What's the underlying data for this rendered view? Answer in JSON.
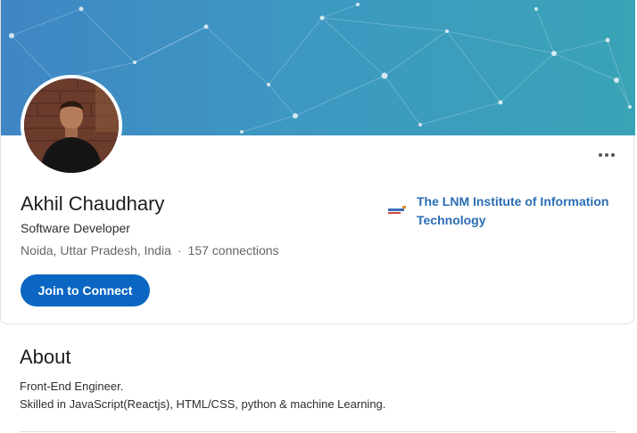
{
  "profile": {
    "name": "Akhil Chaudhary",
    "headline": "Software Developer",
    "location": "Noida, Uttar Pradesh, India",
    "separator": "·",
    "connections": "157 connections",
    "join_button": "Join to Connect",
    "more_icon": "ellipsis-icon"
  },
  "education": {
    "school": "The LNM Institute of Information Technology",
    "logo_icon": "school-logo"
  },
  "about": {
    "title": "About",
    "lines": [
      "Front-End Engineer.",
      "Skilled in JavaScript(Reactjs), HTML/CSS, python & machine Learning."
    ]
  },
  "colors": {
    "accent": "#0a66c2",
    "link": "#2a6db5",
    "cover_start": "#3f86c4",
    "cover_end": "#3aa3b6"
  }
}
